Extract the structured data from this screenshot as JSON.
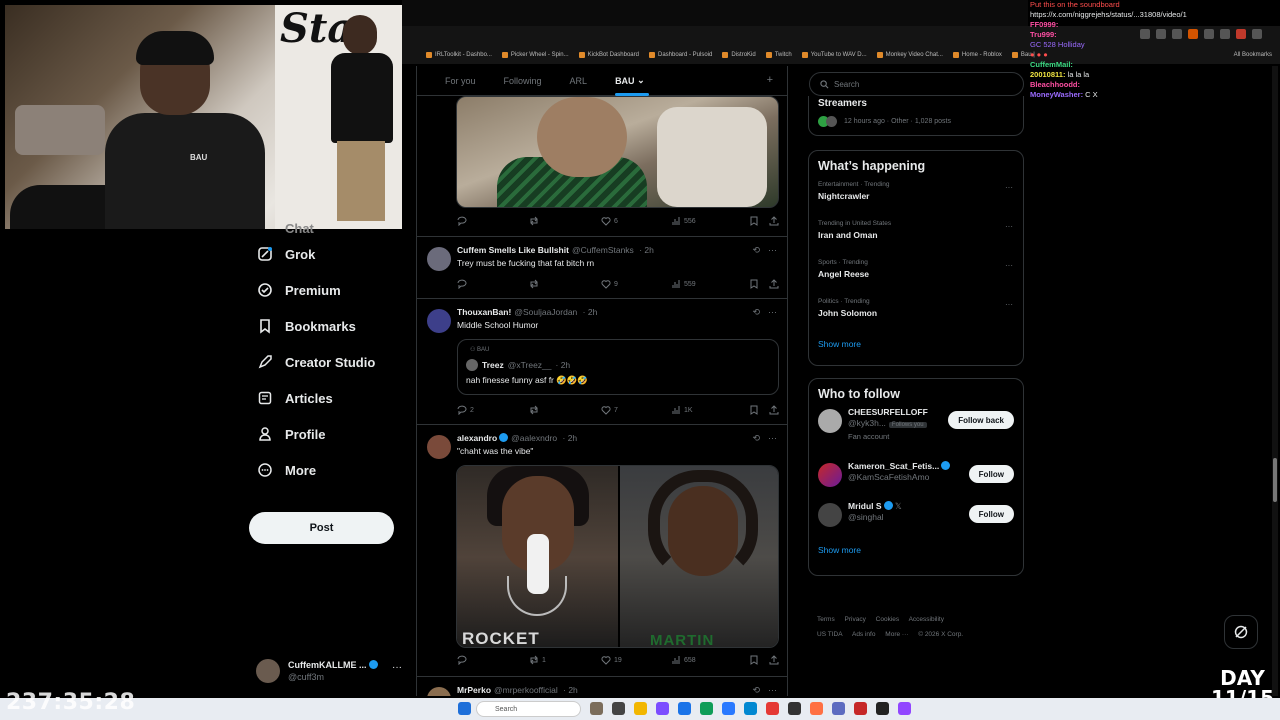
{
  "browser": {
    "url": "https://x.com/niggrejehs/status...",
    "url_tail": "31808/video/1",
    "bookmarks": [
      "IRLToolkit - Dashbo...",
      "Picker Wheel - Spin...",
      "KickBot Dashboard",
      "Dashboard - Pulsoid",
      "DistroKid",
      "Twitch",
      "YouTube to WAV D...",
      "Monkey Video Chat...",
      "Home - Roblox",
      "Bau |"
    ],
    "all_bookmarks": "All Bookmarks"
  },
  "webcam": {
    "sign_text": "Sta",
    "shirt_text": "BAU"
  },
  "nav": {
    "items": [
      {
        "label": "Chat",
        "icon": "chat-icon"
      },
      {
        "label": "Grok",
        "icon": "grok-icon"
      },
      {
        "label": "Premium",
        "icon": "premium-icon"
      },
      {
        "label": "Bookmarks",
        "icon": "bookmark-icon"
      },
      {
        "label": "Creator Studio",
        "icon": "rocket-icon"
      },
      {
        "label": "Articles",
        "icon": "articles-icon"
      },
      {
        "label": "Profile",
        "icon": "profile-icon"
      },
      {
        "label": "More",
        "icon": "more-circle-icon"
      }
    ],
    "post_label": "Post",
    "account": {
      "display_name": "CuffemKALLME ...",
      "handle": "@cuff3m"
    }
  },
  "feed": {
    "tabs": [
      "For you",
      "Following",
      "ARL",
      "BAU"
    ],
    "active_tab": "BAU",
    "first_actions": {
      "replies": "",
      "reposts": "",
      "likes": "6",
      "views": "556"
    },
    "tweets": [
      {
        "display_name": "Cuffem Smells Like Bullshit",
        "handle": "@CuffemStanks",
        "time": "· 2h",
        "text": "Trey must be fucking that fat bitch rn",
        "replies": "",
        "reposts": "",
        "likes": "9",
        "views": "559"
      },
      {
        "display_name": "ThouxanBan!",
        "handle": "@SouljaaJordan",
        "time": "· 2h",
        "text": "Middle School Humor",
        "quote": {
          "context": "BAU",
          "display_name": "Treez",
          "handle": "@xTreez__",
          "time": "· 2h",
          "text": "nah finesse funny asf fr 🤣🤣🤣"
        },
        "replies": "2",
        "reposts": "",
        "likes": "7",
        "views": "1K"
      },
      {
        "display_name": "alexandro",
        "handle": "@aalexndro",
        "time": "· 2h",
        "text": "\"chaht was the vibe\"",
        "jersey_left": "ROCKET",
        "jersey_right": "MARTIN",
        "replies": "",
        "reposts": "1",
        "likes": "19",
        "views": "658"
      },
      {
        "display_name": "MrPerko",
        "handle": "@mrperkoofficial",
        "time": "· 2h",
        "text": ""
      }
    ]
  },
  "right": {
    "search_placeholder": "Search",
    "top_panel": {
      "title": "Streamers",
      "meta": "12 hours ago · Other · 1,028 posts"
    },
    "happening": {
      "title": "What’s happening",
      "trends": [
        {
          "context": "Entertainment · Trending",
          "name": "Nightcrawler"
        },
        {
          "context": "Trending in United States",
          "name": "Iran and Oman"
        },
        {
          "context": "Sports · Trending",
          "name": "Angel Reese"
        },
        {
          "context": "Politics · Trending",
          "name": "John Solomon"
        }
      ],
      "show_more": "Show more"
    },
    "who_to_follow": {
      "title": "Who to follow",
      "accounts": [
        {
          "display_name": "CHEESURFELLOFF",
          "handle": "@kyk3h...",
          "badge": "Follows you",
          "sub": "Fan account",
          "button": "Follow back"
        },
        {
          "display_name": "Kameron_Scat_Fetis...",
          "handle": "@KamScaFetishAmo",
          "badge": "",
          "sub": "",
          "button": "Follow"
        },
        {
          "display_name": "Mridul S",
          "handle": "@singhal",
          "badge": "",
          "sub": "",
          "button": "Follow"
        }
      ],
      "show_more": "Show more"
    },
    "footer": [
      "Terms",
      "Privacy",
      "Cookies",
      "Accessibility",
      "US TIDA",
      "Ads info",
      "More ···",
      "© 2026 X Corp."
    ]
  },
  "chat": [
    {
      "user": "",
      "message": "Put this on the soundboard",
      "color": "#ff4d4d"
    },
    {
      "user": "",
      "message": "https://x.com/niggrejehs/status/...31808/video/1",
      "color": "#ffffff"
    },
    {
      "user": "FF0999:",
      "message": "",
      "color": "#ff4fa3"
    },
    {
      "user": "Tru999:",
      "message": "",
      "color": "#ff4fa3"
    },
    {
      "user": "",
      "message": "GC 528 Holliday",
      "color": "#9b6bff"
    },
    {
      "user": "",
      "message": "",
      "color": "#ff4d4d"
    },
    {
      "user": "CuffemMail:",
      "message": "",
      "color": "#3ddc84"
    },
    {
      "user": "20010811:",
      "message": "la la la",
      "color": "#f0e442"
    },
    {
      "user": "Bleachhoodd:",
      "message": "",
      "color": "#ff4fa3"
    },
    {
      "user": "MoneyWasher:",
      "message": "C X",
      "color": "#9b6bff"
    }
  ],
  "overlays": {
    "timer": "237:35:28",
    "day_label": "DAY",
    "day_count": "11/15"
  },
  "taskbar": {
    "search_placeholder": "Search"
  }
}
